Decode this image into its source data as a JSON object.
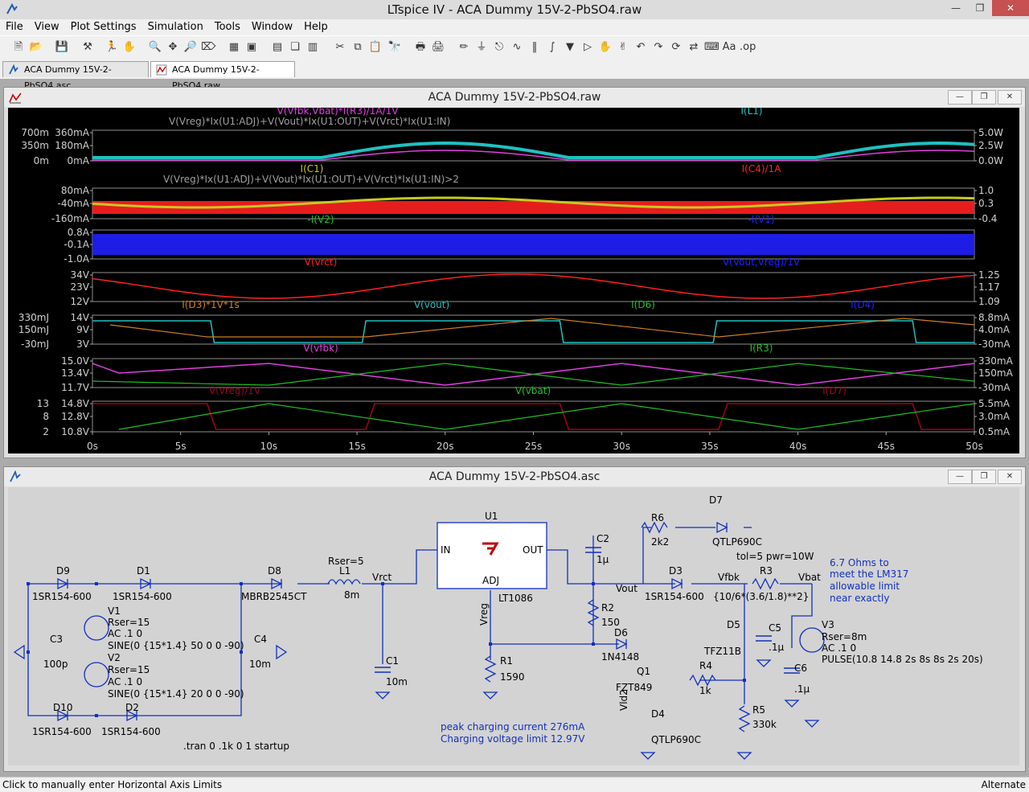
{
  "window": {
    "title": "LTspice IV - ACA Dummy 15V-2-PbSO4.raw"
  },
  "menu": [
    "File",
    "View",
    "Plot Settings",
    "Simulation",
    "Tools",
    "Window",
    "Help"
  ],
  "tabs": [
    {
      "label": "ACA Dummy 15V-2-PbSO4.asc"
    },
    {
      "label": "ACA Dummy 15V-2-PbSO4.raw"
    }
  ],
  "waveform_window": {
    "title": "ACA Dummy 15V-2-PbSO4.raw"
  },
  "schematic_window": {
    "title": "ACA Dummy 15V-2-PbSO4.asc"
  },
  "colors": {
    "plot_bg": "#000000",
    "magenta": "#e040e0",
    "cyan": "#20c0c0",
    "gray": "#a0a0a0",
    "yellow": "#c8c820",
    "red": "#ff2020",
    "green": "#20c020",
    "blue": "#2020ff",
    "darkred": "#a00020",
    "orange": "#d08020"
  },
  "panes": [
    {
      "traces": [
        {
          "label": "V(Vfbk,Vbat)*I(R3)/1A/1V",
          "color": "magenta"
        },
        {
          "label": "V(Vreg)*Ix(U1:ADJ)+V(Vout)*Ix(U1:OUT)+V(Vrct)*Ix(U1:IN)",
          "color": "gray"
        },
        {
          "label": "I(L1)",
          "color": "cyan"
        }
      ],
      "left_ticks": [
        "700m",
        "350m",
        "0m"
      ],
      "left_ticks2": [
        "360mA",
        "180mA",
        "0mA"
      ],
      "right_ticks": [
        "5.0W",
        "2.5W",
        "0.0W"
      ]
    },
    {
      "traces": [
        {
          "label": "I(C1)",
          "color": "yellow"
        },
        {
          "label": "V(Vreg)*Ix(U1:ADJ)+V(Vout)*Ix(U1:OUT)+V(Vrct)*Ix(U1:IN)>2",
          "color": "gray"
        },
        {
          "label": "I(C4)/1A",
          "color": "red"
        }
      ],
      "left_ticks": [
        "80mA",
        "-40mA",
        "-160mA"
      ],
      "right_ticks": [
        "1.0",
        "0.3",
        "-0.4"
      ]
    },
    {
      "traces": [
        {
          "label": "-I(V2)",
          "color": "green"
        },
        {
          "label": "-I(V1)",
          "color": "blue"
        }
      ],
      "left_ticks": [
        "0.8A",
        "-0.1A",
        "-1.0A"
      ],
      "right_ticks": []
    },
    {
      "traces": [
        {
          "label": "V(vrct)",
          "color": "red"
        },
        {
          "label": "V(Vout,Vreg)/1V",
          "color": "blue"
        }
      ],
      "left_ticks": [
        "34V",
        "23V",
        "12V"
      ],
      "right_ticks": [
        "1.25",
        "1.17",
        "1.09"
      ]
    },
    {
      "traces": [
        {
          "label": "I(D3)*1V*1s",
          "color": "orange"
        },
        {
          "label": "V(vout)",
          "color": "cyan"
        },
        {
          "label": "I(D6)",
          "color": "green"
        },
        {
          "label": "I(D4)",
          "color": "blue"
        }
      ],
      "left_ticks": [
        "330mJ",
        "150mJ",
        "-30mJ"
      ],
      "left_ticks2": [
        "14V",
        "9V",
        "3V"
      ],
      "right_ticks": [
        "8.8mA",
        "4.0mA",
        "-30mA"
      ]
    },
    {
      "traces": [
        {
          "label": "V(vfbk)",
          "color": "magenta"
        },
        {
          "label": "I(R3)",
          "color": "green"
        }
      ],
      "left_ticks": [
        "15.0V",
        "13.4V",
        "11.7V"
      ],
      "right_ticks": [
        "330mA",
        "150mA",
        "-30mA"
      ]
    },
    {
      "traces": [
        {
          "label": "V(vreg)/1V",
          "color": "darkred"
        },
        {
          "label": "V(vbat)",
          "color": "green"
        },
        {
          "label": "I(D7)",
          "color": "darkred"
        }
      ],
      "left_ticks": [
        "13",
        "8",
        "2"
      ],
      "left_ticks2": [
        "14.8V",
        "12.8V",
        "10.8V"
      ],
      "right_ticks": [
        "5.5mA",
        "3.0mA",
        "0.5mA"
      ]
    }
  ],
  "x_axis": {
    "ticks": [
      "0s",
      "5s",
      "10s",
      "15s",
      "20s",
      "25s",
      "30s",
      "35s",
      "40s",
      "45s",
      "50s"
    ]
  },
  "schematic": {
    "parts": [
      "D9",
      "1SR154-600",
      "D1",
      "1SR154-600",
      "D8",
      "MBRB2545CT",
      "Rser=5",
      "L1",
      "8m",
      "Vrct",
      "U1",
      "IN",
      "OUT",
      "ADJ",
      "LT1086",
      "C2",
      "1µ",
      "R6",
      "2k2",
      "D7",
      "QTLP690C",
      "tol=5 pwr=10W",
      "6.7 Ohms to",
      "meet the LM317",
      "allowable limit",
      "near exactly",
      "V1",
      "Rser=15",
      "AC .1 0",
      "SINE(0 {15*1.4} 50 0 0 -90)",
      "C3",
      "100p",
      "C4",
      "10m",
      "V2",
      "Rser=15",
      "AC .1 0",
      "SINE(0 {15*1.4} 20 0 0 -90)",
      "D10",
      "1SR154-600",
      "D2",
      "1SR154-600",
      ".tran 0 .1k 0 1 startup",
      "C1",
      "10m",
      "Vreg",
      "R1",
      "1590",
      "peak charging current 276mA",
      "Charging voltage limit 12.97V",
      "Vout",
      "D3",
      "1SR154-600",
      "Vfbk",
      "R3",
      "Vbat",
      "{10/6*(3.6/1.8)**2}",
      "R2",
      "150",
      "D6",
      "1N4148",
      "Q1",
      "FZT849",
      "R4",
      "1k",
      "D5",
      "TFZ11B",
      "C5",
      ".1µ",
      "V3",
      "Rser=8m",
      "AC .1 0",
      "PULSE(10.8 14.8 2s 8s 8s 2s 20s)",
      "C6",
      ".1µ",
      "Vld2",
      "D4",
      "QTLP690C",
      "R5",
      "330k"
    ]
  },
  "status": {
    "left": "Click to manually enter Horizontal Axis Limits",
    "right": "Alternate"
  }
}
